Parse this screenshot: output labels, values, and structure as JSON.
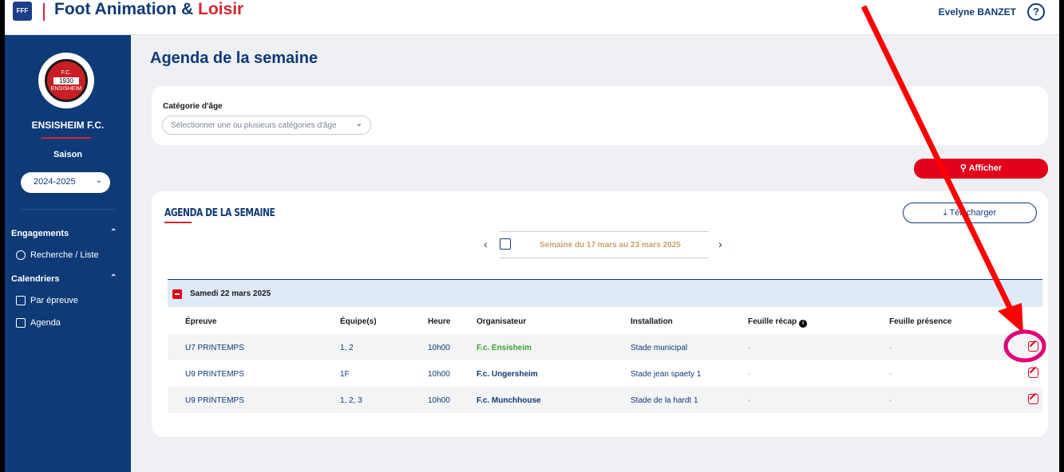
{
  "header": {
    "fff_logo": "FFF",
    "title_part1": "Foot Animation & ",
    "title_part2": "Loisir",
    "user_name": "Evelyne BANZET",
    "help": "?"
  },
  "sidebar": {
    "club_logo_text": "F.C.",
    "club_logo_year": "1930",
    "club_logo_name": "ENSISHEIM",
    "club_name": "ENSISHEIM F.C.",
    "saison_label": "Saison",
    "saison_value": "2024-2025",
    "engagements_label": "Engagements",
    "recherche_label": "Recherche / Liste",
    "calendriers_label": "Calendriers",
    "par_epreuve_label": "Par épreuve",
    "agenda_label": "Agenda"
  },
  "main": {
    "page_title": "Agenda de la semaine",
    "filter_label": "Catégorie d'âge",
    "filter_placeholder": "Sélectionner une ou plusieurs catégories d'âge",
    "afficher_label": "Afficher",
    "agenda_heading": "AGENDA DE LA SEMAINE",
    "telecharger_label": "Télécharger",
    "week_label": "Semaine du 17 mars au 23 mars 2025",
    "day_label": "Samedi 22 mars 2025",
    "columns": {
      "epreuve": "Épreuve",
      "equipes": "Équipe(s)",
      "heure": "Heure",
      "organisateur": "Organisateur",
      "installation": "Installation",
      "feuille_recap": "Feuille récap",
      "feuille_presence": "Feuille présence"
    },
    "rows": [
      {
        "epreuve": "U7 PRINTEMPS",
        "equipes": "1, 2",
        "heure": "10h00",
        "organisateur": "F.c. Ensisheim",
        "installation": "Stade municipal",
        "recap": "-",
        "presence": "-"
      },
      {
        "epreuve": "U9 PRINTEMPS",
        "equipes": "1F",
        "heure": "10h00",
        "organisateur": "F.c. Ungersheim",
        "installation": "Stade jean spaety 1",
        "recap": "-",
        "presence": "-"
      },
      {
        "epreuve": "U9 PRINTEMPS",
        "equipes": "1, 2, 3",
        "heure": "10h00",
        "organisateur": "F.c. Munchhouse",
        "installation": "Stade de la hardt 1",
        "recap": "-",
        "presence": "-"
      }
    ]
  },
  "colors": {
    "brand_blue": "#0f3a78",
    "brand_red": "#e2001a",
    "organizer_highlight": "#3aa52a",
    "annotation_arrow": "#ff0000",
    "annotation_circle": "#e0007a"
  }
}
